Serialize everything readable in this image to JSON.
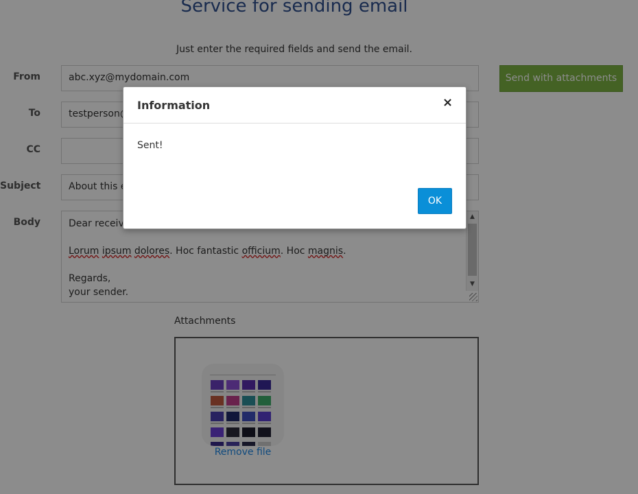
{
  "page": {
    "title": "Service for sending email",
    "subtitle": "Just enter the required fields and send the email."
  },
  "form": {
    "from": {
      "label": "From",
      "value": "abc.xyz@mydomain.com"
    },
    "to": {
      "label": "To",
      "value": "testperson@"
    },
    "cc": {
      "label": "CC",
      "value": ""
    },
    "subject": {
      "label": "Subject",
      "value": "About this e"
    },
    "body": {
      "label": "Body",
      "line1": "Dear receive",
      "line2_parts": [
        "Lorum",
        "ipsum",
        "dolores",
        ". Hoc fantastic ",
        "officium",
        ". Hoc ",
        "magnis",
        "."
      ],
      "line3": "Regards,",
      "line4": "your sender."
    },
    "send_button": "Send with attachments"
  },
  "attachments": {
    "label": "Attachments",
    "remove_link": "Remove file"
  },
  "modal": {
    "title": "Information",
    "close_glyph": "×",
    "message": "Sent!",
    "ok_button": "OK"
  },
  "colors": {
    "accent_green": "#7cb342",
    "ok_blue": "#0a8fd8",
    "link_blue": "#1e88e5",
    "title_blue": "#2f4f8f"
  }
}
